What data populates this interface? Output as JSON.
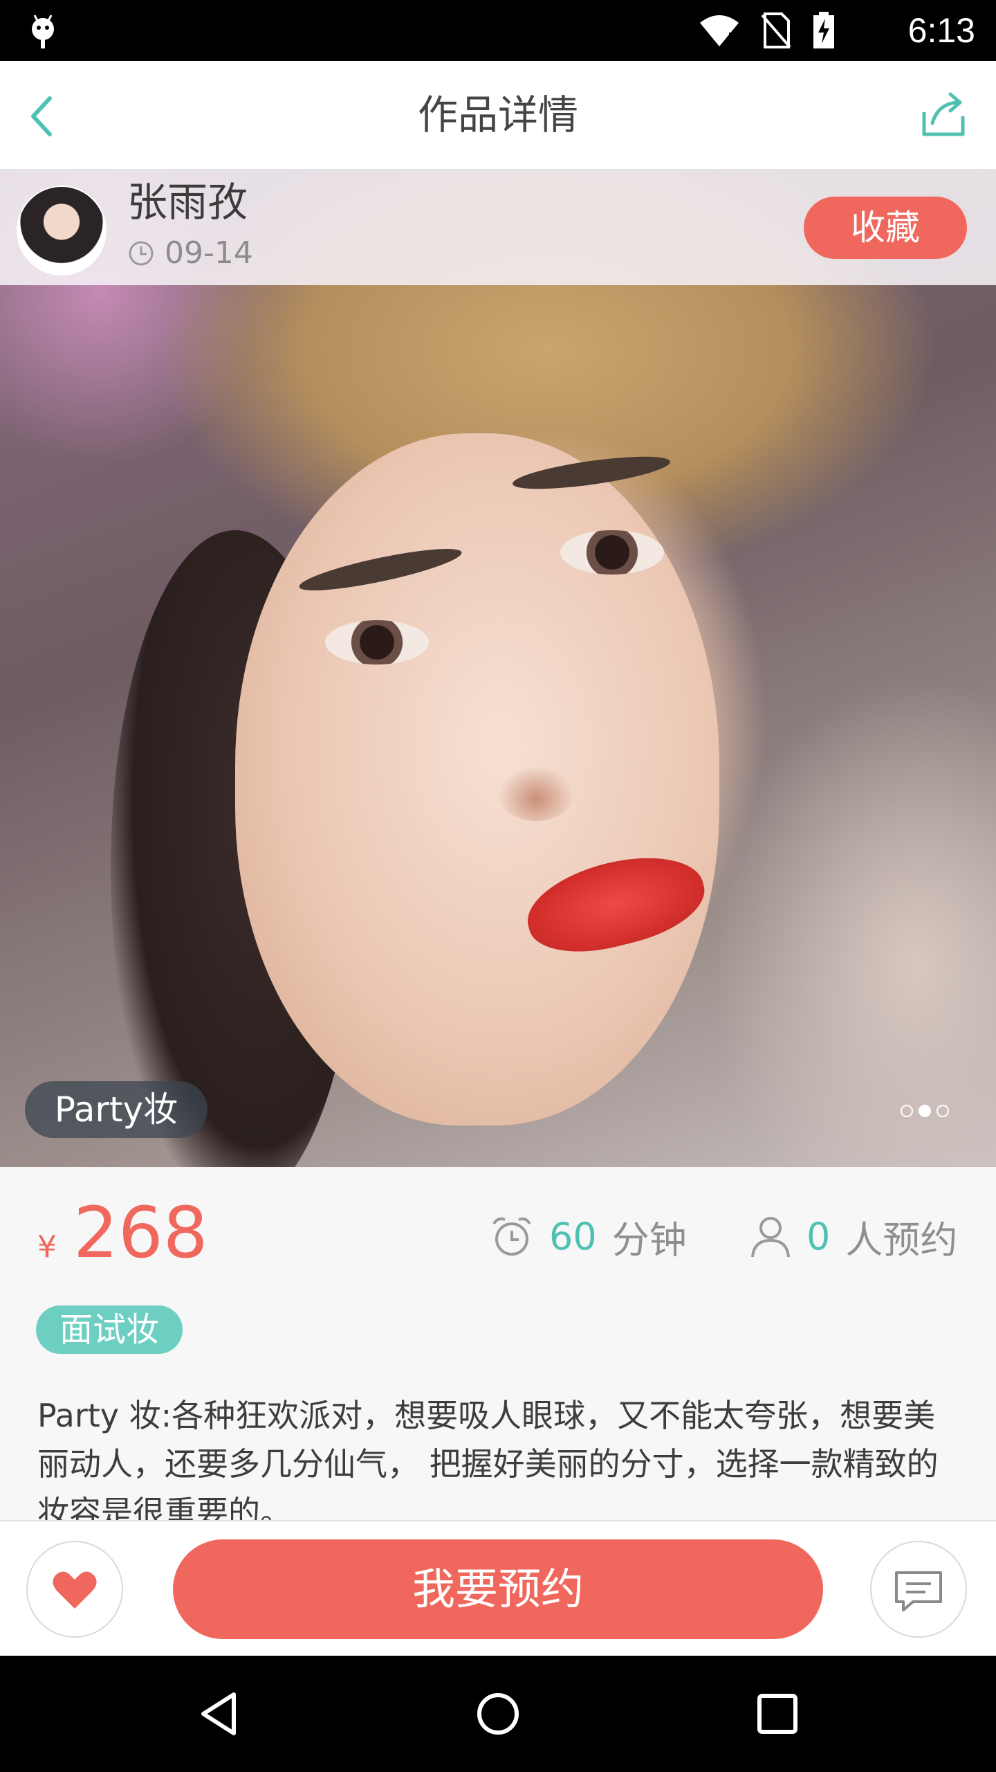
{
  "status_bar": {
    "time": "6:13",
    "icons": [
      "android-debug-icon",
      "wifi-icon",
      "no-sim-icon",
      "battery-charging-icon"
    ]
  },
  "app_bar": {
    "title": "作品详情",
    "back_icon": "chevron-left-icon",
    "share_icon": "share-icon"
  },
  "author": {
    "name": "张雨孜",
    "date": "09-14",
    "favorite_label": "收藏"
  },
  "gallery": {
    "style_tag": "Party妆",
    "page_count": 3,
    "active_index": 1
  },
  "details": {
    "currency": "¥",
    "price": "268",
    "duration_value": "60",
    "duration_unit": "分钟",
    "bookings_value": "0",
    "bookings_unit": "人预约",
    "category": "面试妆",
    "description": "Party 妆:各种狂欢派对，想要吸人眼球，又不能太夸张，想要美丽动人，还要多几分仙气， 把握好美丽的分寸，选择一款精致的妆容是很重要的。"
  },
  "actions": {
    "book_label": "我要预约"
  },
  "colors": {
    "accent_red": "#f0675d",
    "accent_teal": "#4fc1b3",
    "tag_teal": "#6dcfc1"
  }
}
